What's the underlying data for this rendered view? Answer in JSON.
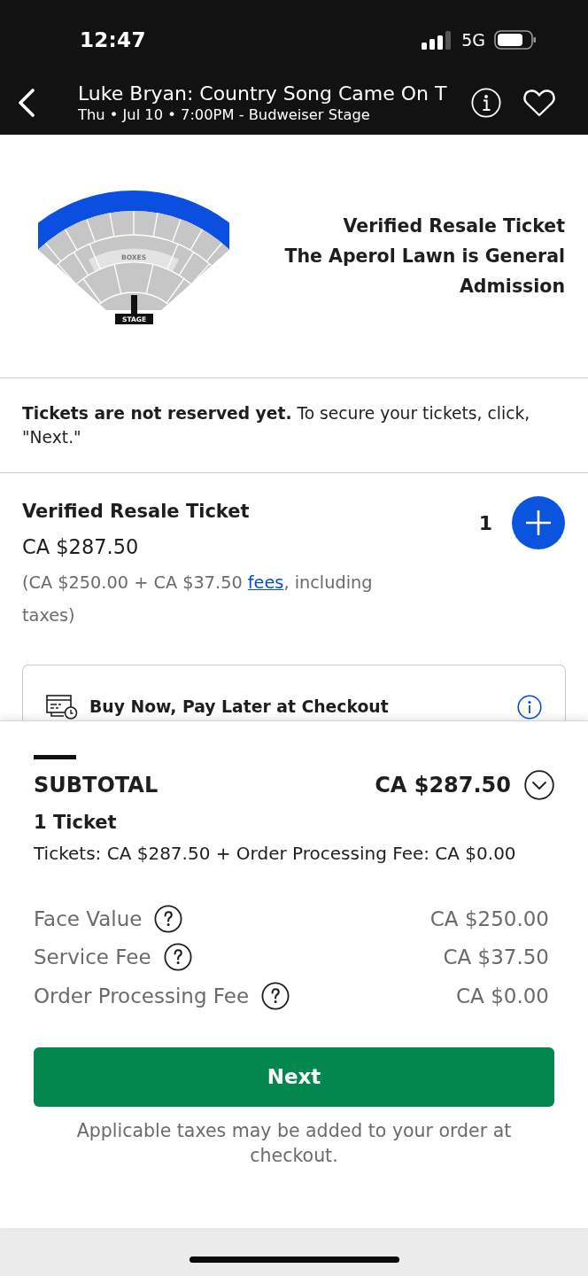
{
  "status_bar": {
    "time": "12:47",
    "network": "5G"
  },
  "header": {
    "title": "Luke Bryan: Country Song Came On T",
    "subtitle": "Thu • Jul 10 • 7:00PM - Budweiser Stage",
    "favorite": false
  },
  "seat_map": {
    "lawn_selected": true,
    "section_label": "BOXES",
    "stage_label": "STAGE",
    "title": "Verified Resale Ticket",
    "section_note": "The Aperol Lawn is General Admission"
  },
  "notice": "**Tickets are not reserved yet.** To secure your tickets, click, \"Next.\"",
  "ticket": {
    "name": "Verified Resale Ticket",
    "price": "CA $287.50",
    "breakdown_before": "(CA $250.00 + CA $37.50 ",
    "fees_link": "fees",
    "breakdown_after": ", including taxes)",
    "quantity": "1"
  },
  "pay_later": {
    "label": "Buy Now, Pay Later at Checkout"
  },
  "subtotal": {
    "label": "SUBTOTAL",
    "amount": "CA $287.50",
    "count": "1 Ticket",
    "summary": "Tickets: CA $287.50 + Order Processing Fee: CA $0.00",
    "fees": [
      {
        "label": "Face Value",
        "value": "CA $250.00"
      },
      {
        "label": "Service Fee",
        "value": "CA $37.50"
      },
      {
        "label": "Order Processing Fee",
        "value": "CA $0.00"
      }
    ]
  },
  "next_button": "Next",
  "tax_note": "Applicable taxes may be added to your order at checkout."
}
